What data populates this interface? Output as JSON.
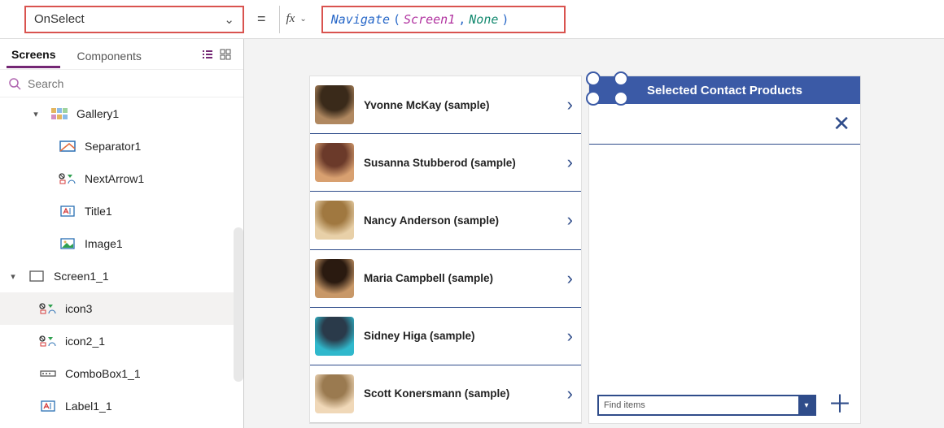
{
  "formula": {
    "property": "OnSelect",
    "fn": "Navigate",
    "arg1": "Screen1",
    "arg2": "None",
    "open": "(",
    "comma": ",",
    "close": ")"
  },
  "panel": {
    "tab_screens": "Screens",
    "tab_components": "Components",
    "search_placeholder": "Search"
  },
  "tree": {
    "gallery1": "Gallery1",
    "separator1": "Separator1",
    "nextarrow1": "NextArrow1",
    "title1": "Title1",
    "image1": "Image1",
    "screen1_1": "Screen1_1",
    "icon3": "icon3",
    "icon2_1": "icon2_1",
    "combobox1_1": "ComboBox1_1",
    "label1_1": "Label1_1"
  },
  "gallery": {
    "rows": [
      {
        "name": "Yvonne McKay (sample)"
      },
      {
        "name": "Susanna Stubberod (sample)"
      },
      {
        "name": "Nancy Anderson (sample)"
      },
      {
        "name": "Maria Campbell (sample)"
      },
      {
        "name": "Sidney Higa (sample)"
      },
      {
        "name": "Scott Konersmann (sample)"
      }
    ]
  },
  "rightpane": {
    "title": "Selected Contact Products",
    "combo_placeholder": "Find items"
  }
}
